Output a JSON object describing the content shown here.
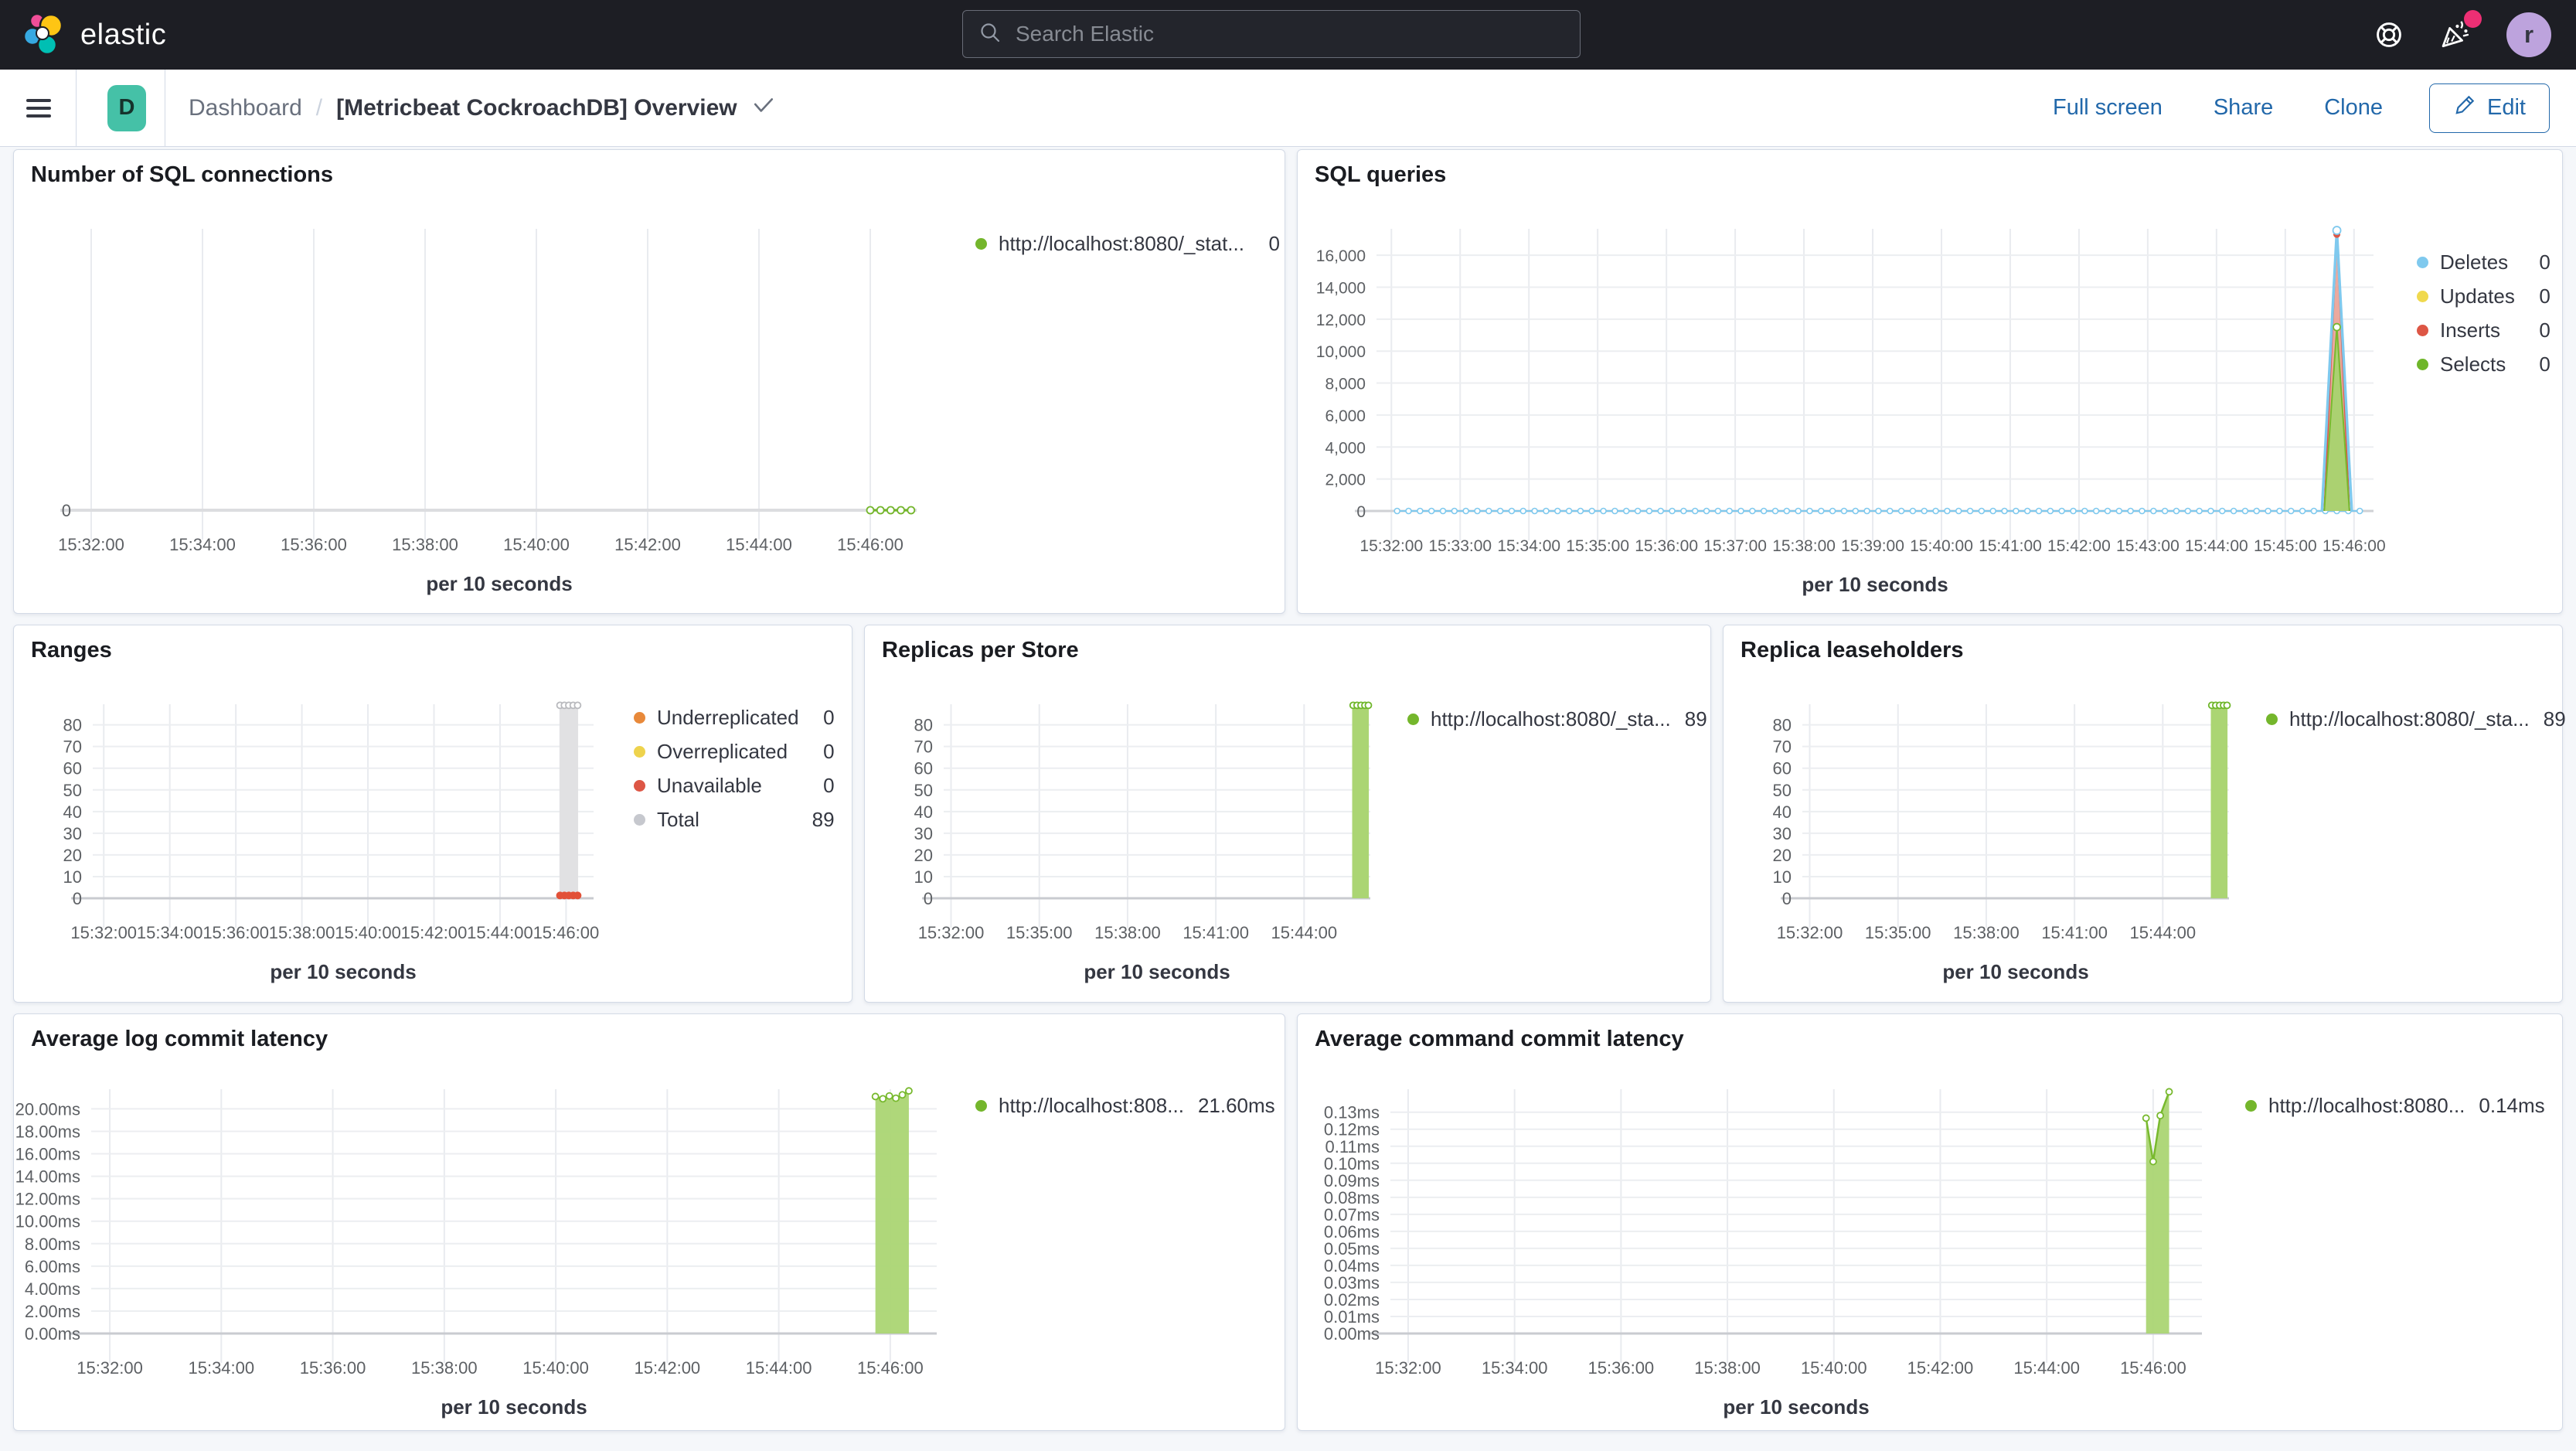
{
  "header": {
    "brand": "elastic",
    "search": {
      "placeholder": "Search Elastic"
    },
    "avatar": "r",
    "notification_color": "#ed2f74"
  },
  "toolbar": {
    "dashboard_badge": "D",
    "breadcrumb": {
      "root": "Dashboard",
      "separator": "/",
      "current": "[Metricbeat CockroachDB] Overview"
    },
    "actions": {
      "full_screen": "Full screen",
      "share": "Share",
      "clone": "Clone",
      "edit": "Edit"
    }
  },
  "colors": {
    "accent_blue": "#2268aa",
    "series_green": "#74b62c",
    "series_green_fill": "#abd573",
    "series_blue": "#7fc9ee",
    "series_yellow": "#f0d94e",
    "series_red": "#dd5645",
    "series_orange": "#e8893a",
    "series_gray": "#c6c8ce"
  },
  "chart_data": [
    {
      "id": "number-of-sql-connections",
      "type": "line",
      "title": "Number of SQL connections",
      "xlabel": "per 10 seconds",
      "x_domain": [
        "15:31:50",
        "15:46:50"
      ],
      "y_max": 1,
      "x_ticks": [
        "15:32:00",
        "15:34:00",
        "15:36:00",
        "15:38:00",
        "15:40:00",
        "15:42:00",
        "15:44:00",
        "15:46:00"
      ],
      "y_ticks": [
        {
          "v": 0,
          "label": "0"
        }
      ],
      "series": [
        {
          "kind": "line",
          "name": "http://localhost:8080/_stat...",
          "color": "#74b62c",
          "width": 3,
          "markers": {
            "r": 4.5,
            "fill": "#ffffff"
          },
          "points": [
            [
              "15:46:00",
              0
            ],
            [
              "15:46:11",
              0
            ],
            [
              "15:46:22",
              0
            ],
            [
              "15:46:33",
              0
            ],
            [
              "15:46:44",
              0
            ]
          ]
        }
      ],
      "legend": [
        {
          "label": "http://localhost:8080/_stat...",
          "value": "0",
          "color": "#74b62c"
        }
      ]
    },
    {
      "id": "sql-queries",
      "type": "area",
      "title": "SQL queries",
      "xlabel": "per 10 seconds",
      "x_domain": [
        "15:31:47",
        "15:46:17"
      ],
      "y_max": 17650,
      "x_ticks": [
        "15:32:00",
        "15:33:00",
        "15:34:00",
        "15:35:00",
        "15:36:00",
        "15:37:00",
        "15:38:00",
        "15:39:00",
        "15:40:00",
        "15:41:00",
        "15:42:00",
        "15:43:00",
        "15:44:00",
        "15:45:00",
        "15:46:00"
      ],
      "y_ticks": [
        {
          "v": 0,
          "label": "0"
        },
        {
          "v": 2000,
          "label": "2,000"
        },
        {
          "v": 4000,
          "label": "4,000"
        },
        {
          "v": 6000,
          "label": "6,000"
        },
        {
          "v": 8000,
          "label": "8,000"
        },
        {
          "v": 10000,
          "label": "10,000"
        },
        {
          "v": 12000,
          "label": "12,000"
        },
        {
          "v": 14000,
          "label": "14,000"
        },
        {
          "v": 16000,
          "label": "16,000"
        }
      ],
      "series": [
        {
          "kind": "zeroline",
          "name": "Deletes",
          "color": "#7fc9ee",
          "y": 0,
          "start": "15:32:05",
          "end": "15:46:12",
          "step_sec": 10,
          "marker_r": 3.5
        },
        {
          "kind": "area",
          "name": "Inserts spike",
          "fill": "#e9a094",
          "fill_opacity": 0.9,
          "stroke": "#dd5645",
          "width": 2,
          "points": [
            [
              "15:45:34",
              0
            ],
            [
              "15:45:45",
              17380
            ],
            [
              "15:45:56",
              0
            ]
          ]
        },
        {
          "kind": "area",
          "name": "Selects spike",
          "fill": "#a8d36f",
          "fill_opacity": 0.95,
          "stroke": "#78b92e",
          "width": 2,
          "points": [
            [
              "15:45:34",
              0
            ],
            [
              "15:45:45",
              11500
            ],
            [
              "15:45:56",
              0
            ]
          ]
        },
        {
          "kind": "line",
          "name": "Deletes spike",
          "color": "#7fc9ee",
          "width": 3.5,
          "points": [
            [
              "15:45:32",
              0
            ],
            [
              "15:45:45",
              17550
            ],
            [
              "15:45:58",
              0
            ]
          ]
        },
        {
          "kind": "dots",
          "name": "inserts-peak",
          "xs": [
            "15:45:45"
          ],
          "y": 17300,
          "r": 4.5,
          "fill": "#dd5645"
        },
        {
          "kind": "dots",
          "name": "deletes-peak",
          "xs": [
            "15:45:45"
          ],
          "y": 17550,
          "r": 5,
          "fill": "#ffffff",
          "stroke": "#7fc9ee"
        },
        {
          "kind": "dots",
          "name": "selects-peak",
          "xs": [
            "15:45:45"
          ],
          "y": 11500,
          "r": 4.5,
          "fill": "#ffffff",
          "stroke": "#78b92e"
        }
      ],
      "legend": [
        {
          "label": "Deletes",
          "value": "0",
          "color": "#7fc9ee"
        },
        {
          "label": "Updates",
          "value": "0",
          "color": "#f0d94e"
        },
        {
          "label": "Inserts",
          "value": "0",
          "color": "#dd5645"
        },
        {
          "label": "Selects",
          "value": "0",
          "color": "#6fb62a"
        }
      ]
    },
    {
      "id": "ranges",
      "type": "bar",
      "title": "Ranges",
      "xlabel": "per 10 seconds",
      "x_domain": [
        "15:31:40",
        "15:46:50"
      ],
      "y_max": 89.5,
      "x_ticks": [
        "15:32:00",
        "15:34:00",
        "15:36:00",
        "15:38:00",
        "15:40:00",
        "15:42:00",
        "15:44:00",
        "15:46:00"
      ],
      "y_ticks": [
        {
          "v": 0,
          "label": "0"
        },
        {
          "v": 10,
          "label": "10"
        },
        {
          "v": 20,
          "label": "20"
        },
        {
          "v": 30,
          "label": "30"
        },
        {
          "v": 40,
          "label": "40"
        },
        {
          "v": 50,
          "label": "50"
        },
        {
          "v": 60,
          "label": "60"
        },
        {
          "v": 70,
          "label": "70"
        },
        {
          "v": 80,
          "label": "80"
        }
      ],
      "series": [
        {
          "kind": "bar",
          "name": "Total",
          "x0": "15:45:48",
          "x1": "15:46:22",
          "y0": 0,
          "y1": 89,
          "fill": "#e1e1e3"
        },
        {
          "kind": "dots",
          "name": "total-top",
          "xs": [
            "15:45:49",
            "15:45:57",
            "15:46:05",
            "15:46:13",
            "15:46:21"
          ],
          "y": 89,
          "r": 4,
          "fill": "#ffffff",
          "stroke": "#b9babe"
        },
        {
          "kind": "dots",
          "name": "unavailable",
          "xs": [
            "15:45:49",
            "15:45:57",
            "15:46:05",
            "15:46:13",
            "15:46:21"
          ],
          "y": 1.3,
          "r": 5,
          "fill": "#e25138"
        }
      ],
      "legend": [
        {
          "label": "Underreplicated",
          "value": "0",
          "color": "#e8893a"
        },
        {
          "label": "Overreplicated",
          "value": "0",
          "color": "#eed34d"
        },
        {
          "label": "Unavailable",
          "value": "0",
          "color": "#dd5645"
        },
        {
          "label": "Total",
          "value": "89",
          "color": "#c6c8ce"
        }
      ]
    },
    {
      "id": "replicas-per-store",
      "type": "bar",
      "title": "Replicas per Store",
      "xlabel": "per 10 seconds",
      "x_domain": [
        "15:31:45",
        "15:46:15"
      ],
      "y_max": 89.5,
      "x_ticks": [
        "15:32:00",
        "15:35:00",
        "15:38:00",
        "15:41:00",
        "15:44:00"
      ],
      "y_ticks": [
        {
          "v": 0,
          "label": "0"
        },
        {
          "v": 10,
          "label": "10"
        },
        {
          "v": 20,
          "label": "20"
        },
        {
          "v": 30,
          "label": "30"
        },
        {
          "v": 40,
          "label": "40"
        },
        {
          "v": 50,
          "label": "50"
        },
        {
          "v": 60,
          "label": "60"
        },
        {
          "v": 70,
          "label": "70"
        },
        {
          "v": 80,
          "label": "80"
        }
      ],
      "series": [
        {
          "kind": "bar",
          "name": "replicas",
          "x0": "15:45:38",
          "x1": "15:46:12",
          "y0": 0,
          "y1": 89,
          "fill": "#abd573"
        },
        {
          "kind": "dots",
          "name": "replicas-top",
          "xs": [
            "15:45:40",
            "15:45:48",
            "15:45:56",
            "15:46:04",
            "15:46:11"
          ],
          "y": 89,
          "r": 4,
          "fill": "#ffffff",
          "stroke": "#6fb62a"
        }
      ],
      "legend": [
        {
          "label": "http://localhost:8080/_sta...",
          "value": "89",
          "color": "#74b62c"
        }
      ]
    },
    {
      "id": "replica-leaseholders",
      "type": "bar",
      "title": "Replica leaseholders",
      "xlabel": "per 10 seconds",
      "x_domain": [
        "15:31:45",
        "15:46:15"
      ],
      "y_max": 89.5,
      "x_ticks": [
        "15:32:00",
        "15:35:00",
        "15:38:00",
        "15:41:00",
        "15:44:00"
      ],
      "y_ticks": [
        {
          "v": 0,
          "label": "0"
        },
        {
          "v": 10,
          "label": "10"
        },
        {
          "v": 20,
          "label": "20"
        },
        {
          "v": 30,
          "label": "30"
        },
        {
          "v": 40,
          "label": "40"
        },
        {
          "v": 50,
          "label": "50"
        },
        {
          "v": 60,
          "label": "60"
        },
        {
          "v": 70,
          "label": "70"
        },
        {
          "v": 80,
          "label": "80"
        }
      ],
      "series": [
        {
          "kind": "bar",
          "name": "leaseholders",
          "x0": "15:45:38",
          "x1": "15:46:12",
          "y0": 0,
          "y1": 89,
          "fill": "#abd573"
        },
        {
          "kind": "dots",
          "name": "leaseholders-top",
          "xs": [
            "15:45:40",
            "15:45:48",
            "15:45:56",
            "15:46:04",
            "15:46:11"
          ],
          "y": 89,
          "r": 4,
          "fill": "#ffffff",
          "stroke": "#6fb62a"
        }
      ],
      "legend": [
        {
          "label": "http://localhost:8080/_sta...",
          "value": "89",
          "color": "#74b62c"
        }
      ]
    },
    {
      "id": "average-log-commit-latency",
      "type": "area",
      "title": "Average log commit latency",
      "xlabel": "per 10 seconds",
      "x_domain": [
        "15:31:40",
        "15:46:50"
      ],
      "y_max": 21.75,
      "x_ticks": [
        "15:32:00",
        "15:34:00",
        "15:36:00",
        "15:38:00",
        "15:40:00",
        "15:42:00",
        "15:44:00",
        "15:46:00"
      ],
      "y_ticks": [
        {
          "v": 0,
          "label": "0.00ms"
        },
        {
          "v": 2,
          "label": "2.00ms"
        },
        {
          "v": 4,
          "label": "4.00ms"
        },
        {
          "v": 6,
          "label": "6.00ms"
        },
        {
          "v": 8,
          "label": "8.00ms"
        },
        {
          "v": 10,
          "label": "10.00ms"
        },
        {
          "v": 12,
          "label": "12.00ms"
        },
        {
          "v": 14,
          "label": "14.00ms"
        },
        {
          "v": 16,
          "label": "16.00ms"
        },
        {
          "v": 18,
          "label": "18.00ms"
        },
        {
          "v": 20,
          "label": "20.00ms"
        }
      ],
      "series": [
        {
          "kind": "area",
          "name": "log-latency",
          "fill": "#abd573",
          "fill_opacity": 0.95,
          "stroke": "#78b92e",
          "width": 2.5,
          "markers": {
            "r": 4,
            "fill": "#ffffff"
          },
          "points": [
            [
              "15:45:44",
              21.1
            ],
            [
              "15:45:52",
              20.9
            ],
            [
              "15:45:59",
              21.15
            ],
            [
              "15:46:06",
              20.95
            ],
            [
              "15:46:13",
              21.25
            ],
            [
              "15:46:20",
              21.6
            ]
          ]
        }
      ],
      "legend": [
        {
          "label": "http://localhost:808...",
          "value": "21.60ms",
          "color": "#74b62c"
        }
      ]
    },
    {
      "id": "average-command-commit-latency",
      "type": "area",
      "title": "Average command commit latency",
      "xlabel": "per 10 seconds",
      "x_domain": [
        "15:31:40",
        "15:46:55"
      ],
      "y_max": 0.1435,
      "x_ticks": [
        "15:32:00",
        "15:34:00",
        "15:36:00",
        "15:38:00",
        "15:40:00",
        "15:42:00",
        "15:44:00",
        "15:46:00"
      ],
      "y_ticks": [
        {
          "v": 0,
          "label": "0.00ms"
        },
        {
          "v": 0.01,
          "label": "0.01ms"
        },
        {
          "v": 0.02,
          "label": "0.02ms"
        },
        {
          "v": 0.03,
          "label": "0.03ms"
        },
        {
          "v": 0.04,
          "label": "0.04ms"
        },
        {
          "v": 0.05,
          "label": "0.05ms"
        },
        {
          "v": 0.06,
          "label": "0.06ms"
        },
        {
          "v": 0.07,
          "label": "0.07ms"
        },
        {
          "v": 0.08,
          "label": "0.08ms"
        },
        {
          "v": 0.09,
          "label": "0.09ms"
        },
        {
          "v": 0.1,
          "label": "0.10ms"
        },
        {
          "v": 0.11,
          "label": "0.11ms"
        },
        {
          "v": 0.12,
          "label": "0.12ms"
        },
        {
          "v": 0.13,
          "label": "0.13ms"
        }
      ],
      "series": [
        {
          "kind": "area",
          "name": "cmd-latency",
          "fill": "#abd573",
          "fill_opacity": 0.95,
          "stroke": "#78b92e",
          "width": 2.5,
          "markers": {
            "r": 4,
            "fill": "#ffffff"
          },
          "points": [
            [
              "15:45:52",
              0.1265
            ],
            [
              "15:46:00",
              0.101
            ],
            [
              "15:46:08",
              0.128
            ],
            [
              "15:46:18",
              0.142
            ]
          ]
        }
      ],
      "legend": [
        {
          "label": "http://localhost:8080...",
          "value": "0.14ms",
          "color": "#74b62c"
        }
      ]
    }
  ]
}
